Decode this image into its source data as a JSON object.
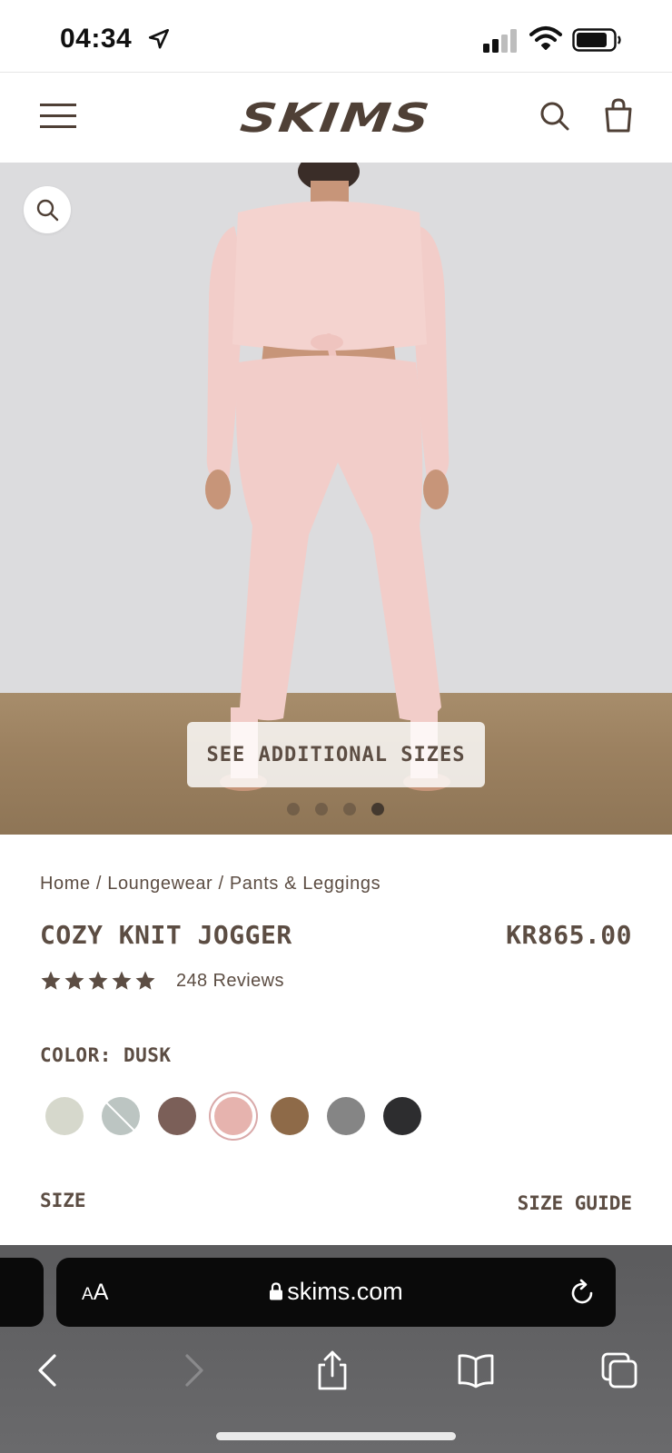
{
  "status_bar": {
    "time": "04:34"
  },
  "header": {
    "logo": "SKIMS"
  },
  "hero": {
    "see_sizes_label": "SEE ADDITIONAL SIZES",
    "carousel_total": 4,
    "carousel_active": 4,
    "colors": {
      "background": "#dcdcde",
      "floor": "#9c8160",
      "garment": "#f2cdc9"
    }
  },
  "product": {
    "breadcrumb": {
      "home": "Home",
      "sep1": " / ",
      "category": "Loungewear",
      "sep2": " / ",
      "subcategory": "Pants & Leggings"
    },
    "title": "COZY KNIT JOGGER",
    "price": "KR865.00",
    "rating_stars": 5,
    "reviews": "248 Reviews",
    "color_label": "COLOR: DUSK",
    "swatches": [
      {
        "name": "light-sage",
        "color": "#d6d8cc",
        "selected": false,
        "unavailable": false
      },
      {
        "name": "mist",
        "color": "#bcc5c2",
        "selected": false,
        "unavailable": true
      },
      {
        "name": "cocoa",
        "color": "#7b5f58",
        "selected": false,
        "unavailable": false
      },
      {
        "name": "dusk",
        "color": "#e6b3ae",
        "selected": true,
        "unavailable": false
      },
      {
        "name": "camel",
        "color": "#8e6a48",
        "selected": false,
        "unavailable": false
      },
      {
        "name": "gray",
        "color": "#858585",
        "selected": false,
        "unavailable": false
      },
      {
        "name": "onyx",
        "color": "#2d2d2f",
        "selected": false,
        "unavailable": false
      }
    ],
    "size_label": "SIZE",
    "size_guide": "SIZE GUIDE"
  },
  "browser": {
    "aa_small": "A",
    "aa_big": "A",
    "url": "skims.com"
  },
  "colors": {
    "brand_text": "#5c4d43",
    "logo": "#4f4036"
  }
}
